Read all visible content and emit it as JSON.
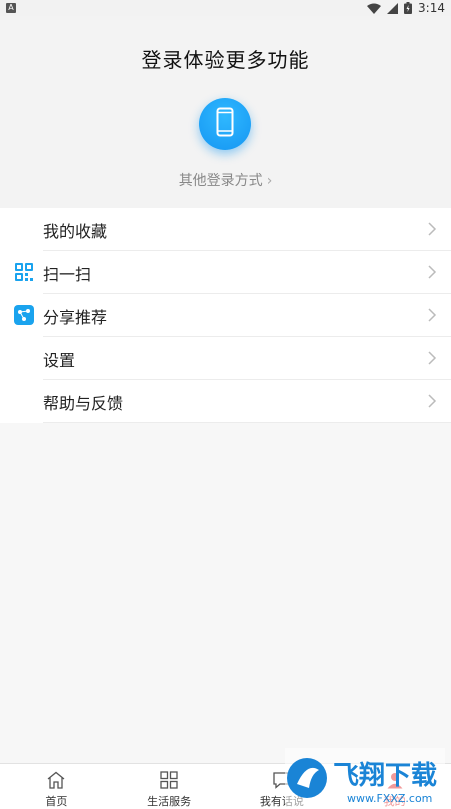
{
  "status_bar": {
    "notification_icon": "A",
    "time": "3:14",
    "icons": [
      "wifi-icon",
      "signal-icon",
      "battery-icon"
    ]
  },
  "header": {
    "title": "登录体验更多功能",
    "phone_login_icon": "phone-icon",
    "other_login": "其他登录方式",
    "chevron": "›"
  },
  "menu": {
    "items": [
      {
        "label": "我的收藏",
        "icon": null
      },
      {
        "label": "扫一扫",
        "icon": "scan-icon"
      },
      {
        "label": "分享推荐",
        "icon": "share-icon"
      },
      {
        "label": "设置",
        "icon": null
      },
      {
        "label": "帮助与反馈",
        "icon": null
      }
    ]
  },
  "tabs": [
    {
      "label": "首页",
      "icon": "home-icon",
      "active": false
    },
    {
      "label": "生活服务",
      "icon": "grid-icon",
      "active": false
    },
    {
      "label": "我有话说",
      "icon": "chat-icon",
      "active": false
    },
    {
      "label": "我的",
      "icon": "user-icon",
      "active": true
    }
  ],
  "watermark": {
    "text": "飞翔下载",
    "domain": "www.FXXZ.com"
  },
  "colors": {
    "accent_blue": "#1596f2",
    "active_tab": "#e02020",
    "background": "#f7f7f7"
  }
}
